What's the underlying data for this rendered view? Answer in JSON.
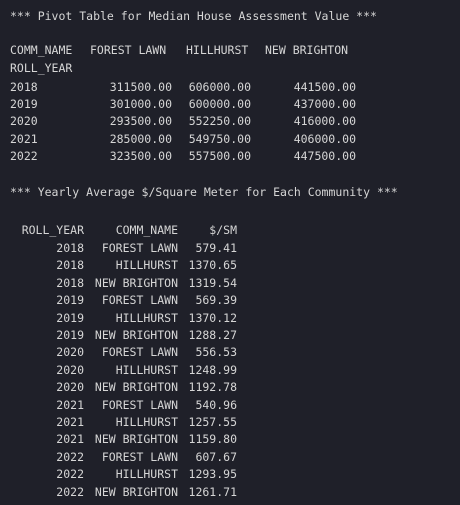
{
  "pivot": {
    "title": "*** Pivot Table for Median House Assessment Value ***",
    "columns_label": "COMM_NAME",
    "columns": [
      "FOREST LAWN",
      "HILLHURST",
      "NEW BRIGHTON"
    ],
    "index_label": "ROLL_YEAR",
    "rows": [
      {
        "year": "2018",
        "values": [
          "311500.00",
          "606000.00",
          "441500.00"
        ]
      },
      {
        "year": "2019",
        "values": [
          "301000.00",
          "600000.00",
          "437000.00"
        ]
      },
      {
        "year": "2020",
        "values": [
          "293500.00",
          "552250.00",
          "416000.00"
        ]
      },
      {
        "year": "2021",
        "values": [
          "285000.00",
          "549750.00",
          "406000.00"
        ]
      },
      {
        "year": "2022",
        "values": [
          "323500.00",
          "557500.00",
          "447500.00"
        ]
      }
    ]
  },
  "yearly": {
    "title": "*** Yearly Average $/Square Meter for Each Community ***",
    "headers": [
      "ROLL_YEAR",
      "COMM_NAME",
      "$/SM"
    ],
    "rows": [
      {
        "year": "2018",
        "name": "FOREST LAWN",
        "value": "579.41"
      },
      {
        "year": "2018",
        "name": "HILLHURST",
        "value": "1370.65"
      },
      {
        "year": "2018",
        "name": "NEW BRIGHTON",
        "value": "1319.54"
      },
      {
        "year": "2019",
        "name": "FOREST LAWN",
        "value": "569.39"
      },
      {
        "year": "2019",
        "name": "HILLHURST",
        "value": "1370.12"
      },
      {
        "year": "2019",
        "name": "NEW BRIGHTON",
        "value": "1288.27"
      },
      {
        "year": "2020",
        "name": "FOREST LAWN",
        "value": "556.53"
      },
      {
        "year": "2020",
        "name": "HILLHURST",
        "value": "1248.99"
      },
      {
        "year": "2020",
        "name": "NEW BRIGHTON",
        "value": "1192.78"
      },
      {
        "year": "2021",
        "name": "FOREST LAWN",
        "value": "540.96"
      },
      {
        "year": "2021",
        "name": "HILLHURST",
        "value": "1257.55"
      },
      {
        "year": "2021",
        "name": "NEW BRIGHTON",
        "value": "1159.80"
      },
      {
        "year": "2022",
        "name": "FOREST LAWN",
        "value": "607.67"
      },
      {
        "year": "2022",
        "name": "HILLHURST",
        "value": "1293.95"
      },
      {
        "year": "2022",
        "name": "NEW BRIGHTON",
        "value": "1261.71"
      }
    ]
  }
}
